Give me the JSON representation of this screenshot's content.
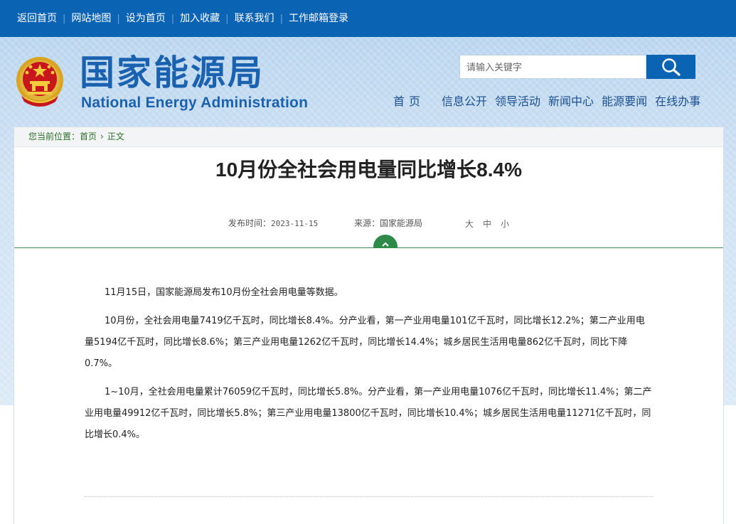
{
  "topbar": {
    "links": [
      "返回首页",
      "网站地图",
      "设为首页",
      "加入收藏",
      "联系我们",
      "工作邮箱登录"
    ]
  },
  "header": {
    "logo_cn": "国家能源局",
    "logo_en": "National Energy Administration",
    "search_placeholder": "请输入关键字",
    "nav": [
      "首页",
      "信息公开",
      "领导活动",
      "新闻中心",
      "能源要闻",
      "在线办事"
    ]
  },
  "breadcrumb": {
    "label": "您当前位置：",
    "items": [
      "首页",
      "正文"
    ]
  },
  "article": {
    "title": "10月份全社会用电量同比增长8.4%",
    "publish_label": "发布时间：",
    "publish_date": "2023-11-15",
    "source_label": "来源：",
    "source": "国家能源局",
    "font_sizes": [
      "大",
      "中",
      "小"
    ],
    "paragraphs": [
      "11月15日，国家能源局发布10月份全社会用电量等数据。",
      "10月份，全社会用电量7419亿千瓦时，同比增长8.4%。分产业看，第一产业用电量101亿千瓦时，同比增长12.2%；第二产业用电量5194亿千瓦时，同比增长8.6%；第三产业用电量1262亿千瓦时，同比增长14.4%；城乡居民生活用电量862亿千瓦时，同比下降0.7%。",
      "1~10月，全社会用电量累计76059亿千瓦时，同比增长5.8%。分产业看，第一产业用电量1076亿千瓦时，同比增长11.4%；第二产业用电量49912亿千瓦时，同比增长5.8%；第三产业用电量13800亿千瓦时，同比增长10.4%；城乡居民生活用电量11271亿千瓦时，同比增长0.4%。"
    ]
  },
  "colors": {
    "topbar": "#0b63b4",
    "brand_blue": "#1a62b0",
    "accent_green": "#2e8b47"
  },
  "icons": {
    "search": "search-icon",
    "emblem": "national-emblem-icon",
    "toggle": "chevron-up-icon"
  }
}
